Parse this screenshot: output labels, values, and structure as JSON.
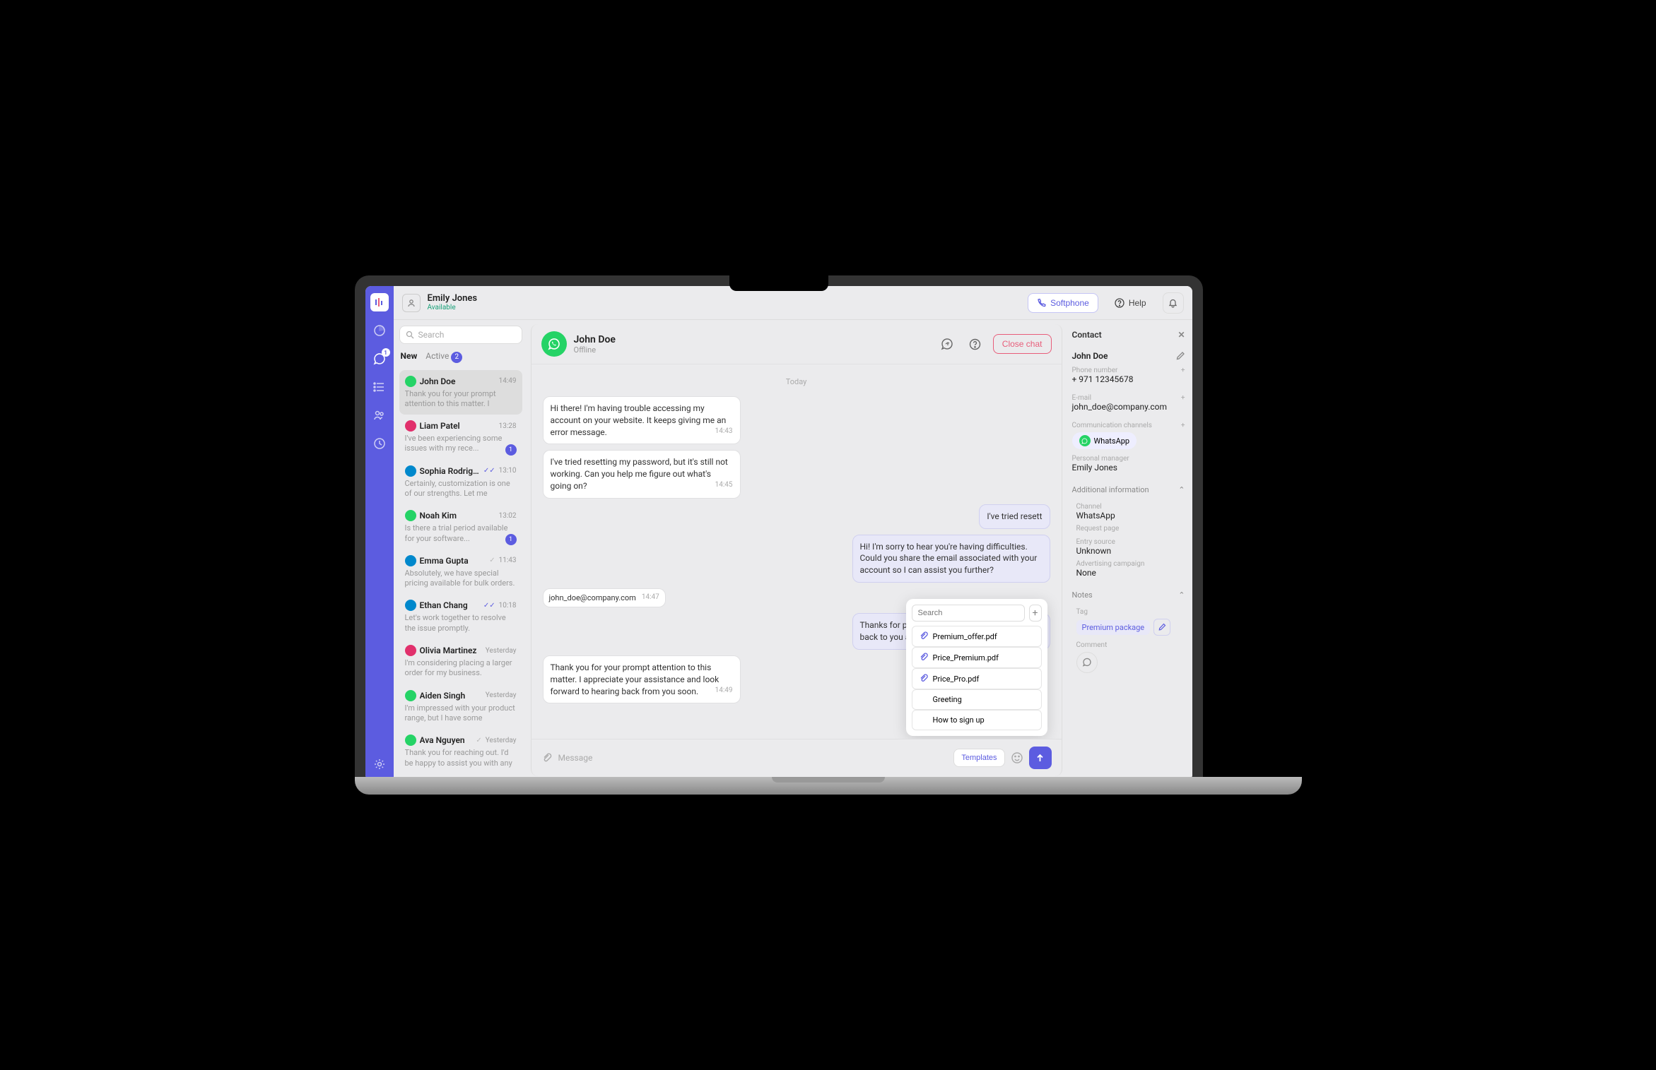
{
  "top": {
    "user_name": "Emily Jones",
    "user_status": "Available",
    "softphone": "Softphone",
    "help": "Help"
  },
  "rail": {
    "chat_badge": "1"
  },
  "list": {
    "search_placeholder": "Search",
    "tab_new": "New",
    "tab_active": "Active",
    "active_count": "2",
    "items": [
      {
        "name": "John Doe",
        "time": "14:49",
        "preview": "Thank you for your prompt attention to this matter. I",
        "channel": "wa",
        "selected": true
      },
      {
        "name": "Liam Patel",
        "time": "13:28",
        "preview": "I've been experiencing some issues with my rece...",
        "channel": "ig",
        "badge": "1"
      },
      {
        "name": "Sophia Rodriguez",
        "time": "13:10",
        "preview": "Certainly, customization is one of our strengths. Let me",
        "channel": "tg",
        "dblcheck": true
      },
      {
        "name": "Noah Kim",
        "time": "13:02",
        "preview": "Is there a trial period available for your software...",
        "channel": "wa",
        "badge": "1"
      },
      {
        "name": "Emma Gupta",
        "time": "11:43",
        "preview": "Absolutely, we have special pricing available for bulk orders.",
        "channel": "tg",
        "graycheck": true
      },
      {
        "name": "Ethan Chang",
        "time": "10:18",
        "preview": "Let's work together to resolve the issue promptly.",
        "channel": "tg",
        "dblcheck": true
      },
      {
        "name": "Olivia Martinez",
        "time": "Yesterday",
        "preview": "I'm considering placing a larger order for my business.",
        "channel": "ig"
      },
      {
        "name": "Aiden Singh",
        "time": "Yesterday",
        "preview": "I'm impressed with your product range, but I have some",
        "channel": "wa"
      },
      {
        "name": "Ava Nguyen",
        "time": "Yesterday",
        "preview": "Thank you for reaching out. I'd be happy to assist you with any",
        "channel": "wa",
        "graycheck": true
      }
    ]
  },
  "chat": {
    "title": "John Doe",
    "status": "Offline",
    "close": "Close chat",
    "day": "Today",
    "messages": [
      {
        "dir": "in",
        "text": "Hi there! I'm having trouble accessing my account on your website. It keeps giving me an error message.",
        "time": "14:43"
      },
      {
        "dir": "in",
        "text": "I've tried resetting my password, but it's still not working. Can you help me figure out what's going on?",
        "time": "14:45"
      },
      {
        "dir": "out",
        "text": "I've tried resett",
        "time": "",
        "partial": true
      },
      {
        "dir": "out",
        "text": "Hi! I'm sorry to hear you're having difficulties. Could you share the email associated with your account so I can assist you further?",
        "time": ""
      },
      {
        "dir": "info",
        "text": "john_doe@company.com",
        "time": "14:47"
      },
      {
        "dir": "out",
        "text": "Thanks for providing that. I'll look into it and get back to you as soon as possible.",
        "time": ""
      },
      {
        "dir": "in",
        "text": "Thank you for your prompt attention to this matter. I appreciate your assistance and look forward to hearing back from you soon.",
        "time": "14:49"
      }
    ],
    "compose_placeholder": "Message",
    "templates_btn": "Templates"
  },
  "templates": {
    "search_placeholder": "Search",
    "items": [
      {
        "label": "Premium_offer.pdf",
        "file": true
      },
      {
        "label": "Price_Premium.pdf",
        "file": true
      },
      {
        "label": "Price_Pro.pdf",
        "file": true
      },
      {
        "label": "Greeting",
        "file": false
      },
      {
        "label": "How to sign up",
        "file": false
      }
    ]
  },
  "contact": {
    "header": "Contact",
    "name": "John Doe",
    "phone_label": "Phone number",
    "phone": "+ 971 12345678",
    "email_label": "E-mail",
    "email": "john_doe@company.com",
    "channels_label": "Communication channels",
    "channel": "WhatsApp",
    "manager_label": "Personal manager",
    "manager": "Emily Jones",
    "addl_label": "Additional information",
    "ch_label": "Channel",
    "ch_value": "WhatsApp",
    "req_label": "Request page",
    "src_label": "Entry source",
    "src_value": "Unknown",
    "adv_label": "Advertising campaign",
    "adv_value": "None",
    "notes_label": "Notes",
    "tag_label": "Tag",
    "tag_value": "Premium package",
    "comment_label": "Comment"
  }
}
